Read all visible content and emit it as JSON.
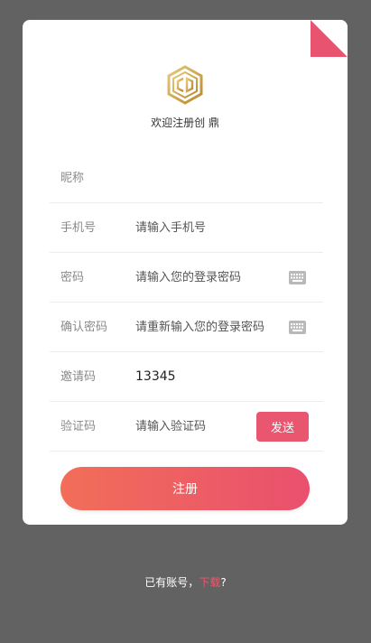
{
  "colors": {
    "background": "#626262",
    "accent": "#e9566f",
    "gradient_start": "#f26e58",
    "gradient_end": "#e9506e",
    "logo_gold": "#d4a94f"
  },
  "header": {
    "logo_icon": "hexagon-logo-icon",
    "welcome": "欢迎注册创 鼎"
  },
  "form": {
    "nickname": {
      "label": "昵称",
      "value": ""
    },
    "phone": {
      "label": "手机号",
      "placeholder": "请输入手机号"
    },
    "password": {
      "label": "密码",
      "placeholder": "请输入您的登录密码",
      "icon": "keyboard-icon"
    },
    "confirm_password": {
      "label": "确认密码",
      "placeholder": "请重新输入您的登录密码",
      "icon": "keyboard-icon"
    },
    "invite_code": {
      "label": "邀请码",
      "value": "13345"
    },
    "verify_code": {
      "label": "验证码",
      "placeholder": "请输入验证码",
      "send_label": "发送"
    },
    "submit_label": "注册"
  },
  "footer": {
    "prefix": "已有账号，",
    "link": "下载",
    "suffix": "?"
  }
}
